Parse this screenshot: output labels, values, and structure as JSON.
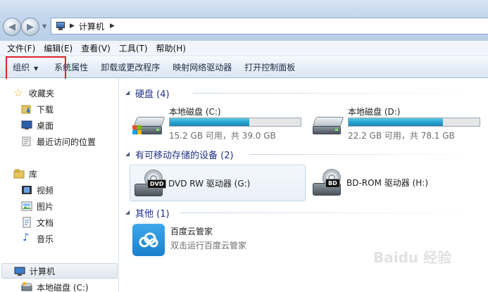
{
  "address": {
    "location": "计算机"
  },
  "menu": [
    "文件(F)",
    "编辑(E)",
    "查看(V)",
    "工具(T)",
    "帮助(H)"
  ],
  "toolbar": {
    "organize": "组织",
    "items": [
      "系统属性",
      "卸载或更改程序",
      "映射网络驱动器",
      "打开控制面板"
    ]
  },
  "sidebar": {
    "favorites": "收藏夹",
    "favorites_items": [
      "下载",
      "桌面",
      "最近访问的位置"
    ],
    "libraries": "库",
    "libraries_items": [
      "视频",
      "图片",
      "文档",
      "音乐"
    ],
    "computer": "计算机",
    "computer_items": [
      "本地磁盘 (C:)"
    ]
  },
  "groups": {
    "hard_disks": "硬盘 (4)",
    "removable": "有可移动存储的设备 (2)",
    "other": "其他 (1)"
  },
  "drives": [
    {
      "name": "本地磁盘 (C:)",
      "info": "15.2 GB 可用，共 39.0 GB",
      "used_fraction": 0.61
    },
    {
      "name": "本地磁盘 (D:)",
      "info": "22.2 GB 可用，共 78.1 GB",
      "used_fraction": 0.72
    }
  ],
  "optical": [
    {
      "name": "DVD RW 驱动器 (G:)",
      "badge": "DVD"
    },
    {
      "name": "BD-ROM 驱动器 (H:)",
      "badge": "BD"
    }
  ],
  "apps": [
    {
      "name": "百度云管家",
      "desc": "双击运行百度云管家"
    }
  ],
  "watermark": "Baidu 经验"
}
